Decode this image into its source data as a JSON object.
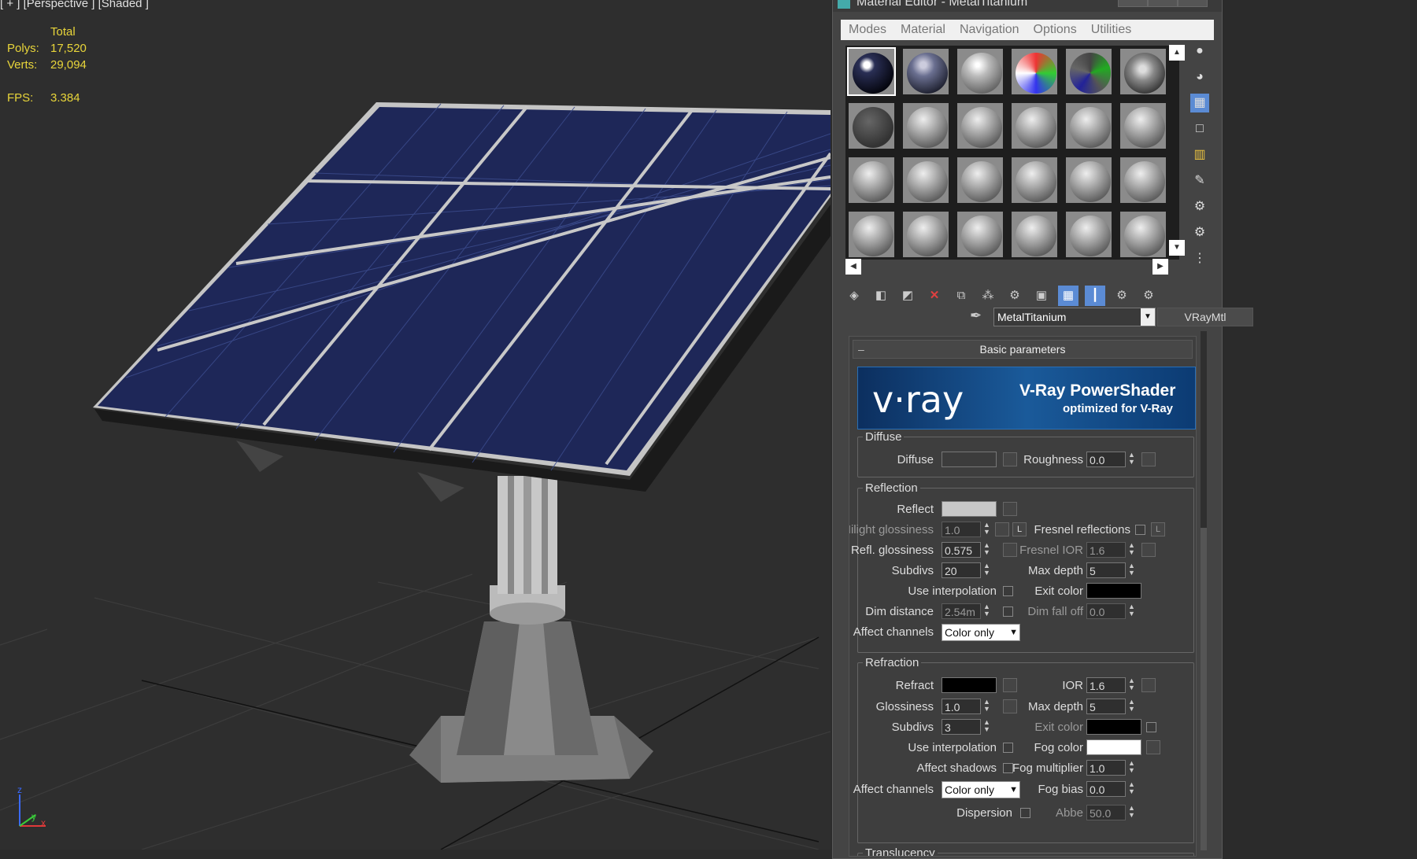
{
  "viewport": {
    "label": "[ + ] [Perspective ] [Shaded ]",
    "stats": {
      "header": "Total",
      "polys_label": "Polys:",
      "polys": "17,520",
      "verts_label": "Verts:",
      "verts": "29,094",
      "fps_label": "FPS:",
      "fps": "3.384"
    }
  },
  "editor": {
    "title": "Material Editor - MetalTitanium",
    "menu": [
      "Modes",
      "Material",
      "Navigation",
      "Options",
      "Utilities"
    ],
    "material_name": "MetalTitanium",
    "material_type": "VRayMtl",
    "rollout_title": "Basic parameters",
    "banner": {
      "logo": "v·ray",
      "title": "V-Ray PowerShader",
      "subtitle": "optimized for V-Ray"
    }
  },
  "diffuse": {
    "group": "Diffuse",
    "diffuse_label": "Diffuse",
    "roughness_label": "Roughness",
    "roughness": "0.0"
  },
  "reflection": {
    "group": "Reflection",
    "reflect_label": "Reflect",
    "hilight_label": "Hilight glossiness",
    "hilight": "1.0",
    "lock_label": "L",
    "fresnel_label": "Fresnel reflections",
    "refl_gloss_label": "Refl. glossiness",
    "refl_gloss": "0.575",
    "fresnel_ior_label": "Fresnel IOR",
    "fresnel_ior": "1.6",
    "subdivs_label": "Subdivs",
    "subdivs": "20",
    "max_depth_label": "Max depth",
    "max_depth": "5",
    "use_interp_label": "Use interpolation",
    "exit_color_label": "Exit color",
    "dim_distance_label": "Dim distance",
    "dim_distance": "2.54m",
    "dim_falloff_label": "Dim fall off",
    "dim_falloff": "0.0",
    "affect_channels_label": "Affect channels",
    "affect_channels": "Color only"
  },
  "refraction": {
    "group": "Refraction",
    "refract_label": "Refract",
    "ior_label": "IOR",
    "ior": "1.6",
    "gloss_label": "Glossiness",
    "gloss": "1.0",
    "max_depth_label": "Max depth",
    "max_depth": "5",
    "subdivs_label": "Subdivs",
    "subdivs": "3",
    "exit_color_label": "Exit color",
    "use_interp_label": "Use interpolation",
    "fog_color_label": "Fog color",
    "affect_shadows_label": "Affect shadows",
    "fog_mult_label": "Fog multiplier",
    "fog_mult": "1.0",
    "affect_channels_label": "Affect channels",
    "affect_channels": "Color only",
    "fog_bias_label": "Fog bias",
    "fog_bias": "0.0",
    "dispersion_label": "Dispersion",
    "abbe_label": "Abbe",
    "abbe": "50.0"
  },
  "translucency": {
    "group": "Translucency"
  }
}
